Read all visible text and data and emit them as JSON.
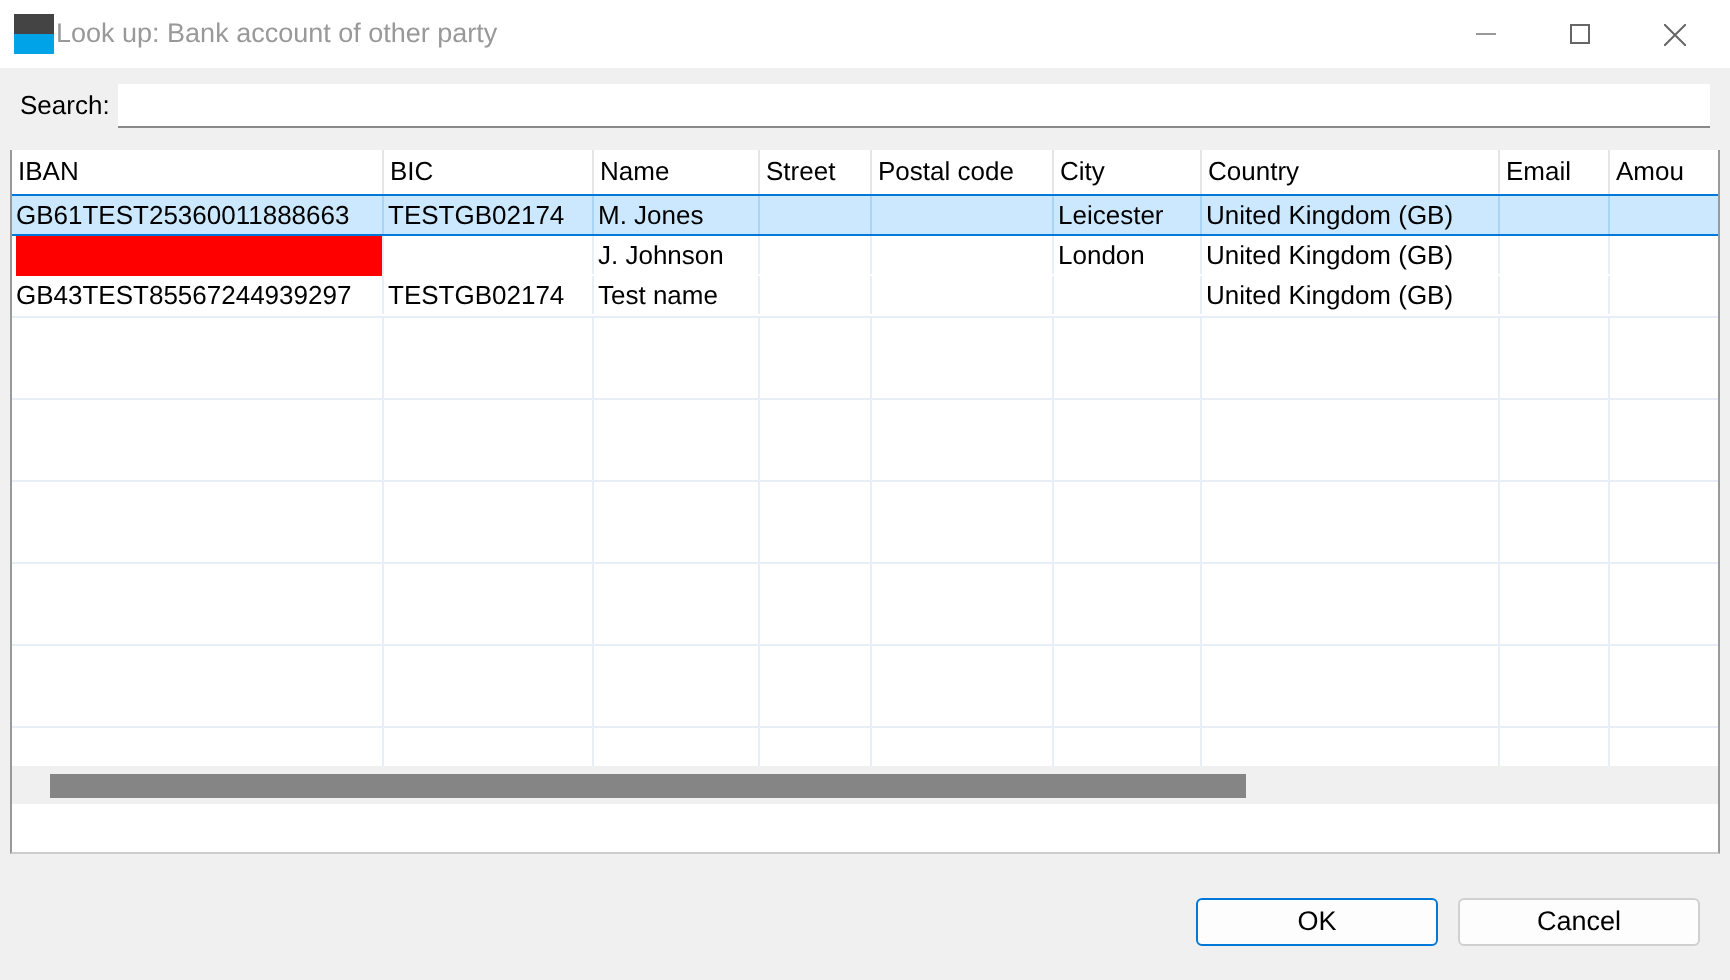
{
  "window": {
    "title": "Look up: Bank account of other party"
  },
  "search": {
    "label": "Search:"
  },
  "table": {
    "columns": [
      "IBAN",
      "BIC",
      "Name",
      "Street",
      "Postal code",
      "City",
      "Country",
      "Email",
      "Amou"
    ],
    "rows": [
      {
        "selected": true,
        "iban_redacted": false,
        "cells": [
          "GB61TEST25360011888663",
          "TESTGB02174",
          "M. Jones",
          "",
          "",
          "Leicester",
          "United Kingdom (GB)",
          "",
          ""
        ]
      },
      {
        "selected": false,
        "iban_redacted": true,
        "cells": [
          "",
          "",
          "J. Johnson",
          "",
          "",
          "London",
          "United Kingdom (GB)",
          "",
          ""
        ]
      },
      {
        "selected": false,
        "iban_redacted": false,
        "cells": [
          "GB43TEST85567244939297",
          "TESTGB02174",
          "Test name",
          "",
          "",
          "",
          "United Kingdom (GB)",
          "",
          ""
        ]
      }
    ]
  },
  "buttons": [
    {
      "label": "OK",
      "selected": true
    },
    {
      "label": "Cancel",
      "selected": false
    }
  ]
}
